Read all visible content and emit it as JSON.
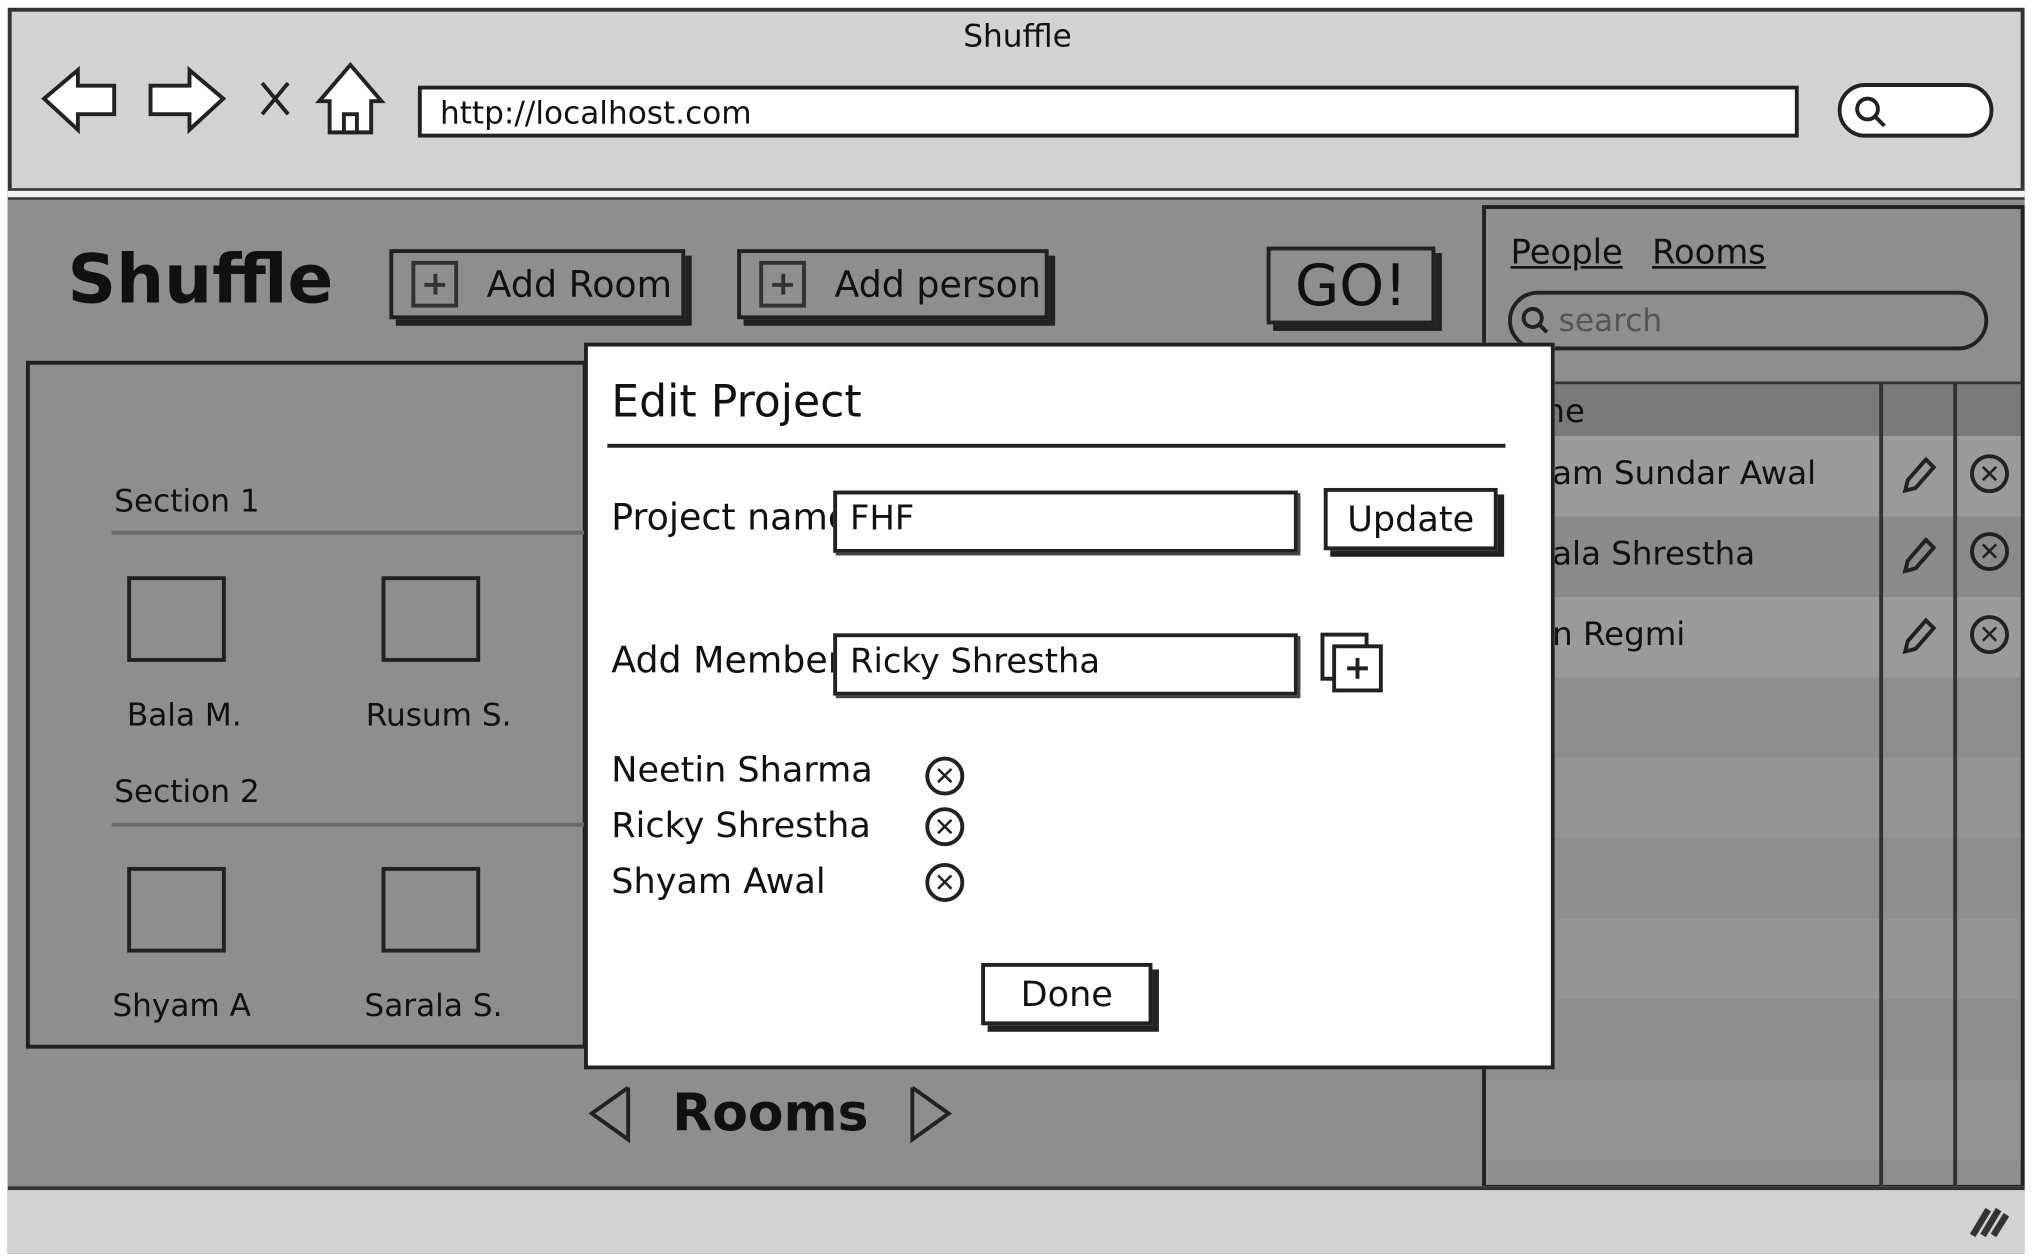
{
  "browser": {
    "window_title": "Shuffle",
    "url": "http://localhost.com",
    "nav_icons": [
      "back-arrow-icon",
      "forward-arrow-icon",
      "stop-icon",
      "home-icon"
    ]
  },
  "app": {
    "title": "Shuffle",
    "add_room_label": "Add Room",
    "add_person_label": "Add person",
    "go_label": "GO!"
  },
  "rooms_panel": {
    "sections": [
      {
        "label": "Section 1",
        "rooms": [
          "Bala M.",
          "Rusum S."
        ]
      },
      {
        "label": "Section 2",
        "rooms": [
          "Shyam A",
          "Sarala S."
        ]
      }
    ],
    "nav_label": "Rooms"
  },
  "right_panel": {
    "tabs": [
      "People",
      "Rooms"
    ],
    "search_placeholder": "search",
    "column_header": "ne",
    "rows": [
      "am Sundar Awal",
      "ala Shrestha",
      "n Regmi"
    ]
  },
  "modal": {
    "title": "Edit Project",
    "project_name_label": "Project name",
    "project_name_value": "FHF",
    "update_label": "Update",
    "add_member_label": "Add Member",
    "add_member_value": "Ricky Shrestha",
    "members": [
      "Neetin Sharma",
      "Ricky Shrestha",
      "Shyam Awal"
    ],
    "done_label": "Done"
  }
}
